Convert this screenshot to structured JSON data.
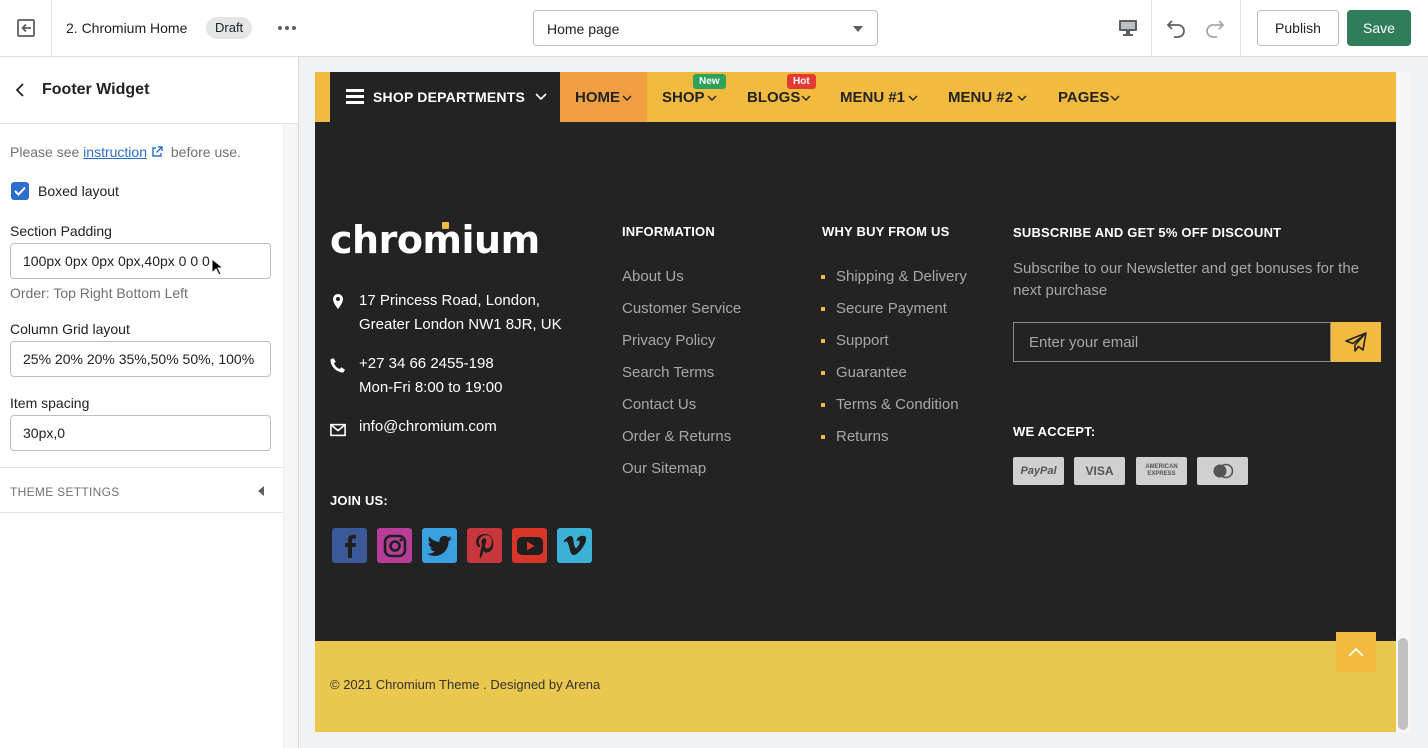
{
  "topbar": {
    "theme_name": "2. Chromium Home",
    "status_badge": "Draft",
    "page_select_value": "Home page",
    "publish_label": "Publish",
    "save_label": "Save"
  },
  "sidebar": {
    "title": "Footer Widget",
    "note_prefix": "Please see",
    "note_link": "instruction",
    "note_suffix": "before use.",
    "boxed_layout_label": "Boxed layout",
    "boxed_layout_checked": true,
    "section_padding_label": "Section Padding",
    "section_padding_value": "100px 0px 0px 0px,40px 0 0 0",
    "section_padding_help": "Order: Top Right Bottom Left",
    "column_grid_label": "Column Grid layout",
    "column_grid_value": "25% 20% 20% 35%,50% 50%, 100%",
    "item_spacing_label": "Item spacing",
    "item_spacing_value": "30px,0",
    "theme_settings_label": "THEME SETTINGS"
  },
  "preview": {
    "nav": {
      "departments_label": "SHOP DEPARTMENTS",
      "items": [
        {
          "label": "HOME",
          "badge": ""
        },
        {
          "label": "SHOP",
          "badge": "New"
        },
        {
          "label": "BLOGS",
          "badge": "Hot"
        },
        {
          "label": "MENU #1",
          "badge": ""
        },
        {
          "label": "MENU #2",
          "badge": ""
        },
        {
          "label": "PAGES",
          "badge": ""
        }
      ],
      "badge_colors": {
        "new": "#2ea15b",
        "hot": "#e53935"
      }
    },
    "footer": {
      "logo_text": "chromium",
      "address_line1": "17 Princess Road, London,",
      "address_line2": "Greater London NW1 8JR, UK",
      "phone": "+27 34 66 2455-198",
      "hours": "Mon-Fri 8:00 to 19:00",
      "email": "info@chromium.com",
      "join_us": "JOIN US:",
      "info_heading": "INFORMATION",
      "info_links": [
        "About Us",
        "Customer Service",
        "Privacy Policy",
        "Search Terms",
        "Contact Us",
        "Order & Returns",
        "Our Sitemap"
      ],
      "why_heading": "WHY BUY FROM US",
      "why_links": [
        "Shipping & Delivery",
        "Secure Payment",
        "Support",
        "Guarantee",
        "Terms & Condition",
        "Returns"
      ],
      "subscribe_heading": "SUBSCRIBE AND GET 5% OFF DISCOUNT",
      "subscribe_text": "Subscribe to our Newsletter and get bonuses for the next purchase",
      "email_placeholder": "Enter your email",
      "we_accept": "WE ACCEPT:",
      "payment_cards": [
        "PayPal",
        "VISA",
        "AMERICAN EXPRESS",
        "mastercard"
      ],
      "copyright": "© 2021 Chromium Theme . Designed by Arena"
    },
    "colors": {
      "accent": "#f2bb40",
      "footer_bg": "#232323",
      "bottom_bar": "#eac74e"
    }
  }
}
